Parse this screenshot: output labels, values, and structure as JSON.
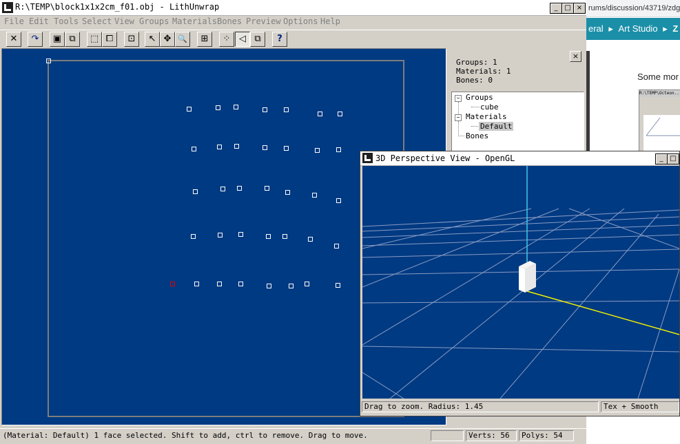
{
  "browser": {
    "url": "rums/discussion/43719/zdg",
    "nav_items": [
      "eral",
      "Art Studio",
      "Z"
    ],
    "body_text": "Some mor",
    "thumb_title": "R:\\TEMP\\Octeon..."
  },
  "window": {
    "title": "R:\\TEMP\\block1x1x2cm_f01.obj - LithUnwrap",
    "controls": {
      "minimize": "_",
      "maximize": "□",
      "close": "×"
    }
  },
  "menu": [
    "File",
    "Edit",
    "Tools",
    "Select",
    "View",
    "Groups",
    "Materials",
    "Bones",
    "Preview",
    "Options",
    "Help"
  ],
  "toolbar": {
    "buttons": [
      {
        "name": "close-model",
        "icon": "x-icon",
        "glyph": "✕"
      },
      {
        "name": "redo",
        "icon": "redo-arrow-icon",
        "glyph": "↷"
      },
      {
        "name": "save",
        "icon": "floppy-disk-icon",
        "glyph": "▣"
      },
      {
        "name": "copy",
        "icon": "copy-icon",
        "glyph": "⧉"
      },
      {
        "name": "select-rect",
        "icon": "marquee-icon",
        "glyph": "⬚"
      },
      {
        "name": "select-lasso",
        "icon": "lasso-icon",
        "glyph": "⧠"
      },
      {
        "name": "select-center",
        "icon": "target-box-icon",
        "glyph": "⊡"
      },
      {
        "name": "pointer",
        "icon": "cursor-arrow-icon",
        "glyph": "↖"
      },
      {
        "name": "move",
        "icon": "move-arrows-icon",
        "glyph": "✥"
      },
      {
        "name": "zoom",
        "icon": "magnifier-icon",
        "glyph": "🔍"
      },
      {
        "name": "zoom-fit",
        "icon": "zoom-fit-icon",
        "glyph": "⊞"
      },
      {
        "name": "vertex-mode",
        "icon": "vertex-mode-icon",
        "glyph": "⁘"
      },
      {
        "name": "face-mode",
        "icon": "face-mode-icon",
        "glyph": "◁"
      },
      {
        "name": "group-mode",
        "icon": "group-mode-icon",
        "glyph": "⧉"
      },
      {
        "name": "help",
        "icon": "help-pointer-icon",
        "glyph": "?"
      }
    ]
  },
  "side_panel": {
    "close_label": "×",
    "stats": [
      "Groups: 1",
      "Materials: 1",
      "Bones: 0"
    ],
    "tree": {
      "groups": "Groups",
      "group_child": "cube",
      "materials": "Materials",
      "material_child": "Default",
      "bones": "Bones"
    }
  },
  "view3d": {
    "title": "3D Perspective View - OpenGL",
    "status_left": "Drag to zoom. Radius: 1.45",
    "status_right": "Tex + Smooth",
    "controls": {
      "minimize": "_",
      "maximize": "□"
    }
  },
  "statusbar": {
    "message": "(Material: Default) 1 face selected.  Shift to add, ctrl to remove.  Drag to move.",
    "verts": "Verts: 56",
    "polys": "Polys: 54"
  }
}
